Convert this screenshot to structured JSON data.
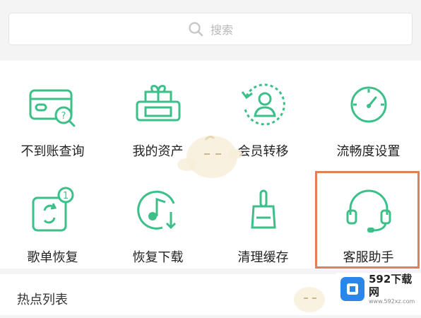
{
  "search": {
    "placeholder": "搜索"
  },
  "menu": {
    "items": [
      {
        "label": "不到账查询",
        "icon": "card-question-icon"
      },
      {
        "label": "我的资产",
        "icon": "gift-box-icon"
      },
      {
        "label": "会员转移",
        "icon": "user-transfer-icon"
      },
      {
        "label": "流畅度设置",
        "icon": "speedometer-icon"
      },
      {
        "label": "歌单恢复",
        "icon": "playlist-restore-icon",
        "badge": "1"
      },
      {
        "label": "恢复下载",
        "icon": "music-download-icon"
      },
      {
        "label": "清理缓存",
        "icon": "broom-icon"
      },
      {
        "label": "客服助手",
        "icon": "headset-icon"
      }
    ]
  },
  "section": {
    "title": "热点列表"
  },
  "watermark": {
    "main": "592下载网",
    "sub": "www.592xz.com"
  },
  "colors": {
    "accent": "#3dbf8a",
    "highlight": "#e0805a"
  }
}
